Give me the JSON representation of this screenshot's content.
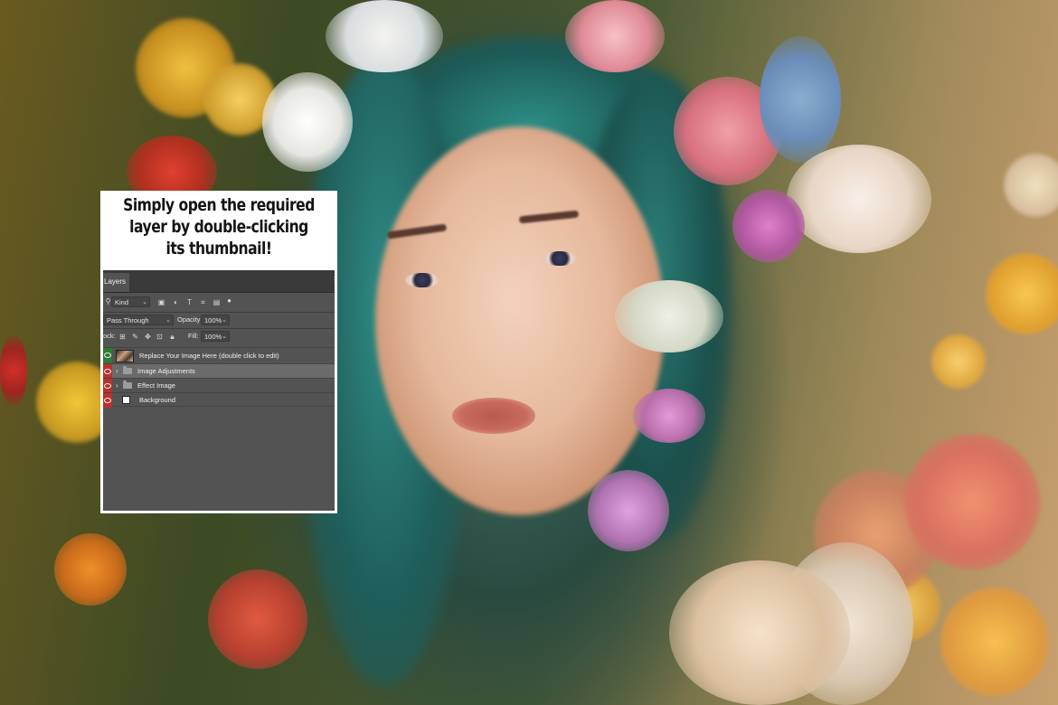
{
  "card": {
    "title_lines": [
      "Simply open the required",
      "layer by double-clicking",
      "its thumbnail!"
    ]
  },
  "layers_panel": {
    "tab_label": "Layers",
    "filter_kind": "Kind",
    "blend_mode": "Pass Through",
    "opacity_label": "Opacity:",
    "opacity_value": "100%",
    "lock_label": "ock:",
    "fill_label": "Fill:",
    "fill_value": "100%",
    "layers": [
      {
        "name": "Replace Your Image Here (double click to edit)",
        "type": "smart-object",
        "selected": false,
        "eye_color": "green"
      },
      {
        "name": "Image Adjustments",
        "type": "group",
        "selected": true,
        "eye_color": "red"
      },
      {
        "name": "Effect Image",
        "type": "group",
        "selected": false,
        "eye_color": "red"
      },
      {
        "name": "Background",
        "type": "background",
        "selected": false,
        "eye_color": "red"
      }
    ]
  }
}
